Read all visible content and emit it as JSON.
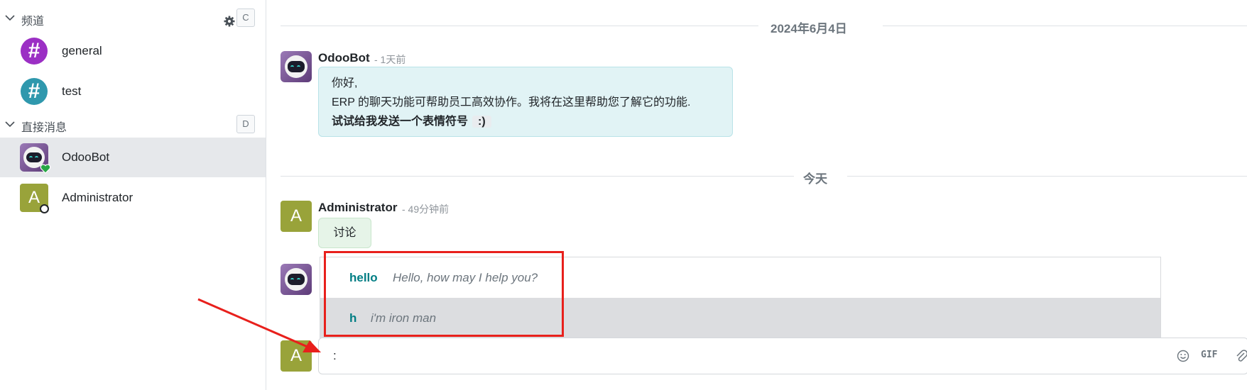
{
  "sidebar": {
    "channels_header": "频道",
    "channels_hotkey": "C",
    "channels": [
      {
        "label": "general",
        "color": "#9b2fc4"
      },
      {
        "label": "test",
        "color": "#2f98ad"
      }
    ],
    "dm_header": "直接消息",
    "dm_hotkey": "D",
    "dms": [
      {
        "label": "OdooBot",
        "status": "online",
        "status_color": "#28a745"
      },
      {
        "label": "Administrator",
        "avatar_letter": "A",
        "status": "offline"
      }
    ]
  },
  "thread": {
    "date_separator_1": "2024年6月4日",
    "date_separator_2": "今天",
    "messages": [
      {
        "author": "OdooBot",
        "meta": "- 1天前",
        "lines": [
          "你好,",
          "ERP 的聊天功能可帮助员工高效协作。我将在这里帮助您了解它的功能."
        ],
        "bold_line": "试试给我发送一个表情符号",
        "code": ":)"
      },
      {
        "author": "Administrator",
        "avatar_letter": "A",
        "meta": "- 49分钟前",
        "text": "讨论"
      }
    ]
  },
  "suggestions": [
    {
      "key": "hello",
      "value": "Hello, how may I help you?",
      "highlighted": false
    },
    {
      "key": "h",
      "value": "i'm iron man",
      "highlighted": true
    }
  ],
  "composer": {
    "avatar_letter": "A",
    "value": ":",
    "gif_label": "GIF",
    "icons": [
      "smiley-icon",
      "gif-icon",
      "paperclip-icon"
    ]
  },
  "colors": {
    "accent": "#017e84",
    "annotation_red": "#e8201c"
  }
}
